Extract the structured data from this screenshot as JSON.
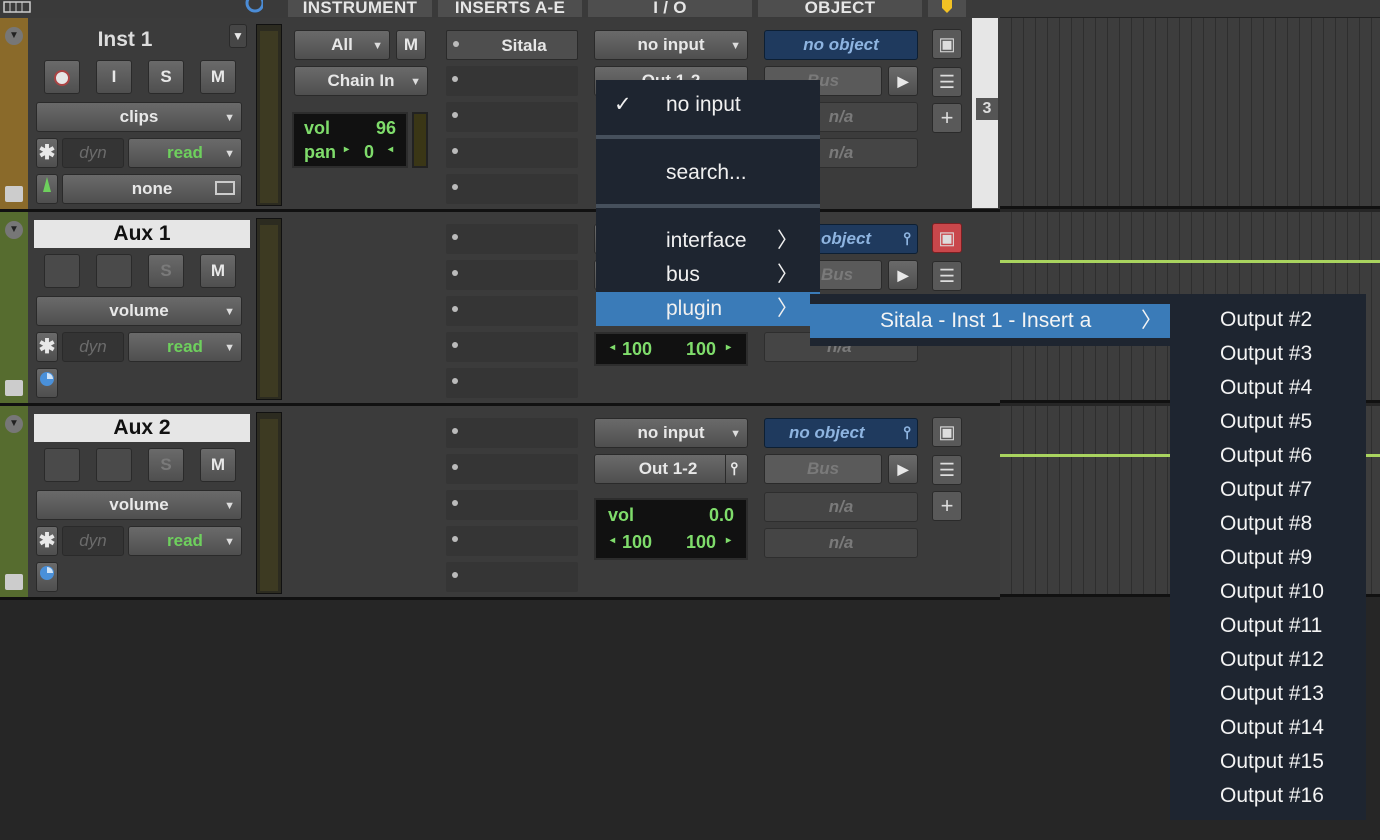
{
  "header": {
    "instrument": "INSTRUMENT",
    "inserts": "INSERTS A-E",
    "io": "I / O",
    "object": "OBJECT"
  },
  "tracks": [
    {
      "name": "Inst 1",
      "color": "#8a6a2a",
      "rec": "●",
      "input": "I",
      "solo": "S",
      "mute": "M",
      "view": "clips",
      "dyn": "dyn",
      "auto_mode": "read",
      "group": "none",
      "instrument": {
        "all": "All",
        "m": "M",
        "chain": "Chain In",
        "vol_label": "vol",
        "vol_value": "96",
        "pan_label": "pan",
        "pan_value": "0"
      },
      "insert_a": "Sitala",
      "io_input": "no input",
      "io_output": "Out 1-2",
      "object": "no object",
      "bus": "Bus",
      "na1": "n/a",
      "na2": "n/a"
    },
    {
      "name": "Aux 1",
      "color": "#566c2f",
      "solo": "S",
      "mute": "M",
      "view": "volume",
      "dyn": "dyn",
      "auto_mode": "read",
      "pan_left": "100",
      "pan_right": "100",
      "object": "object",
      "bus": "Bus",
      "na1": "n/a"
    },
    {
      "name": "Aux 2",
      "color": "#566c2f",
      "solo": "S",
      "mute": "M",
      "view": "volume",
      "dyn": "dyn",
      "auto_mode": "read",
      "io_input": "no input",
      "io_output": "Out 1-2",
      "vol_label": "vol",
      "vol_value": "0.0",
      "pan_left": "100",
      "pan_right": "100",
      "object": "no object",
      "bus": "Bus",
      "na1": "n/a",
      "na2": "n/a"
    }
  ],
  "timeline_marker": "3",
  "menu": {
    "check": "✓",
    "no_input": "no input",
    "search": "search...",
    "interface": "interface",
    "bus": "bus",
    "plugin": "plugin",
    "chevron": "〉"
  },
  "submenu": {
    "label": "Sitala - Inst 1 - Insert a",
    "chevron": "〉"
  },
  "outputs": [
    "Output #2",
    "Output #3",
    "Output #4",
    "Output #5",
    "Output #6",
    "Output #7",
    "Output #8",
    "Output #9",
    "Output #10",
    "Output #11",
    "Output #12",
    "Output #13",
    "Output #14",
    "Output #15",
    "Output #16"
  ],
  "colors": {
    "menu_bg": "#1e2530",
    "menu_selected": "#3a7bb8",
    "automation_line": "#a9d45f",
    "green_text": "#6ed05d",
    "object_blue": "#1f3a5e"
  }
}
